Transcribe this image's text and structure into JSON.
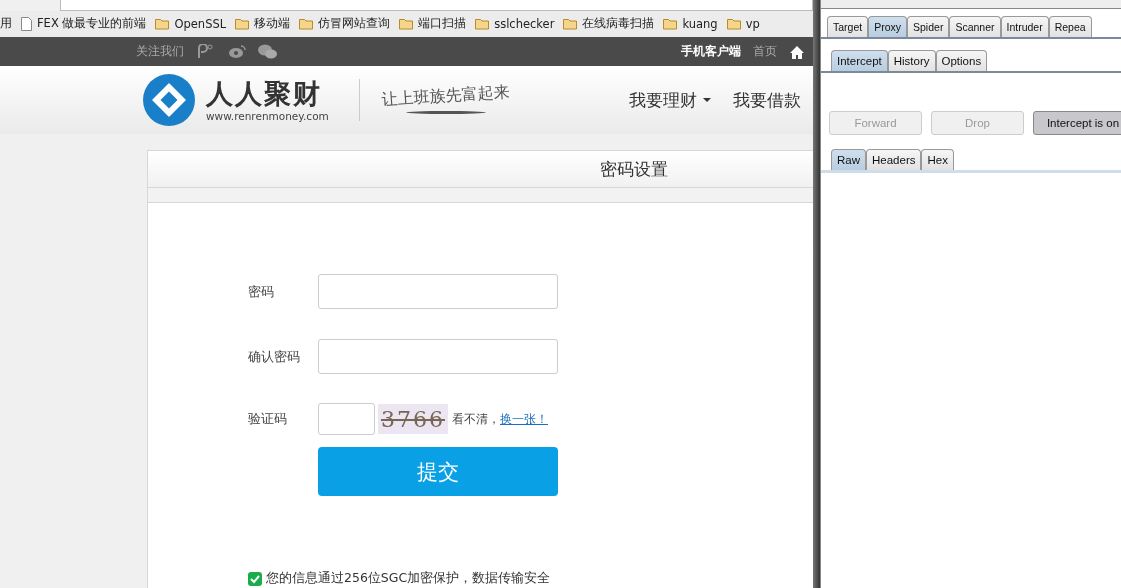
{
  "bookmarks": [
    {
      "label": "用",
      "kind": "apps"
    },
    {
      "label": "FEX 做最专业的前端",
      "kind": "page"
    },
    {
      "label": "OpenSSL",
      "kind": "folder"
    },
    {
      "label": "移动端",
      "kind": "folder"
    },
    {
      "label": "仿冒网站查询",
      "kind": "folder"
    },
    {
      "label": "端口扫描",
      "kind": "folder"
    },
    {
      "label": "sslchecker",
      "kind": "folder"
    },
    {
      "label": "在线病毒扫描",
      "kind": "folder"
    },
    {
      "label": "kuang",
      "kind": "folder"
    },
    {
      "label": "vp",
      "kind": "folder"
    }
  ],
  "topbar": {
    "follow": "关注我们",
    "mobile": "手机客户端",
    "home": "首页"
  },
  "header": {
    "brand": "人人聚财",
    "domain": "www.renrenmoney.com",
    "slogan": "让上班族先富起来",
    "nav": [
      {
        "label": "我要理财",
        "dropdown": true
      },
      {
        "label": "我要借款",
        "dropdown": false
      }
    ]
  },
  "form": {
    "title": "密码设置",
    "fields": [
      {
        "label": "密码",
        "kind": "password"
      },
      {
        "label": "确认密码",
        "kind": "password"
      },
      {
        "label": "验证码",
        "kind": "captcha"
      }
    ],
    "captcha": "3766",
    "unclear": "看不清，",
    "refresh": "换一张！",
    "submit": "提交",
    "security": "您的信息通过256位SGC加密保护，数据传输安全"
  },
  "burp": {
    "tabs": [
      {
        "label": "Target",
        "selected": false
      },
      {
        "label": "Proxy",
        "selected": true
      },
      {
        "label": "Spider",
        "selected": false
      },
      {
        "label": "Scanner",
        "selected": false
      },
      {
        "label": "Intruder",
        "selected": false
      },
      {
        "label": "Repea",
        "selected": false
      }
    ],
    "subtabs": [
      {
        "label": "Intercept",
        "selected": true
      },
      {
        "label": "History",
        "selected": false
      },
      {
        "label": "Options",
        "selected": false
      }
    ],
    "buttons": [
      {
        "label": "Forward",
        "disabled": true,
        "on": false
      },
      {
        "label": "Drop",
        "disabled": true,
        "on": false
      },
      {
        "label": "Intercept is on",
        "disabled": false,
        "on": true
      }
    ],
    "viewtabs": [
      {
        "label": "Raw",
        "selected": true
      },
      {
        "label": "Headers",
        "selected": false
      },
      {
        "label": "Hex",
        "selected": false
      }
    ]
  }
}
